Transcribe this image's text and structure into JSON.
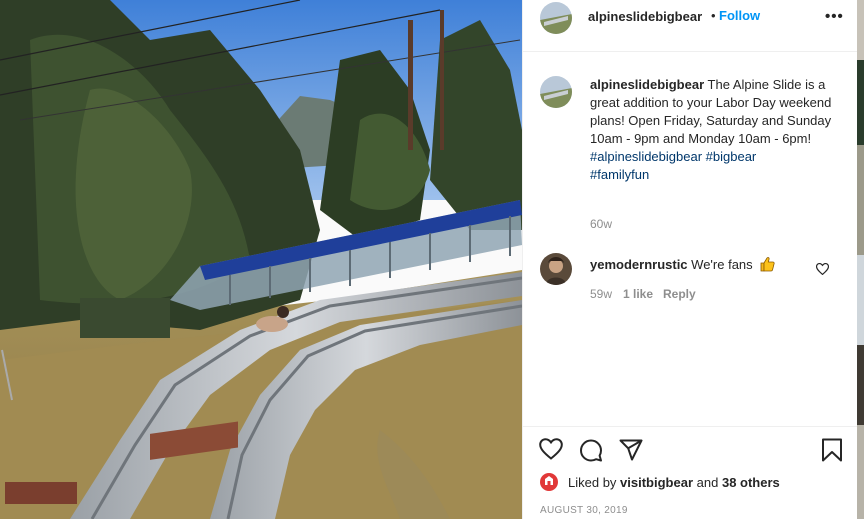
{
  "post": {
    "author": "alpineslidebigbear",
    "separator": "•",
    "follow_label": "Follow",
    "more_icon": "more-options-icon",
    "more_label": "•••"
  },
  "caption": {
    "author": "alpineslidebigbear",
    "text": "The Alpine Slide is a great addition to your Labor Day weekend plans! Open Friday, Saturday and Sunday 10am - 9pm and Monday 10am - 6pm!",
    "hashtags": [
      "#alpineslidebigbear",
      "#bigbear",
      "#familyfun"
    ],
    "age": "60w"
  },
  "comment": {
    "author": "yemodernrustic",
    "text": "We're fans",
    "emoji_icon": "thumbs-up-emoji",
    "age": "59w",
    "likes": "1 like",
    "reply_label": "Reply"
  },
  "likes": {
    "prefix": "Liked by",
    "user": "visitbigbear",
    "conjunction": "and",
    "others": "38 others"
  },
  "date": "AUGUST 30, 2019",
  "colors": {
    "link_blue": "#0095f6",
    "hashtag_blue": "#00376b",
    "muted": "#8e8e8e",
    "text": "#262626",
    "badge_red": "#e13838"
  }
}
